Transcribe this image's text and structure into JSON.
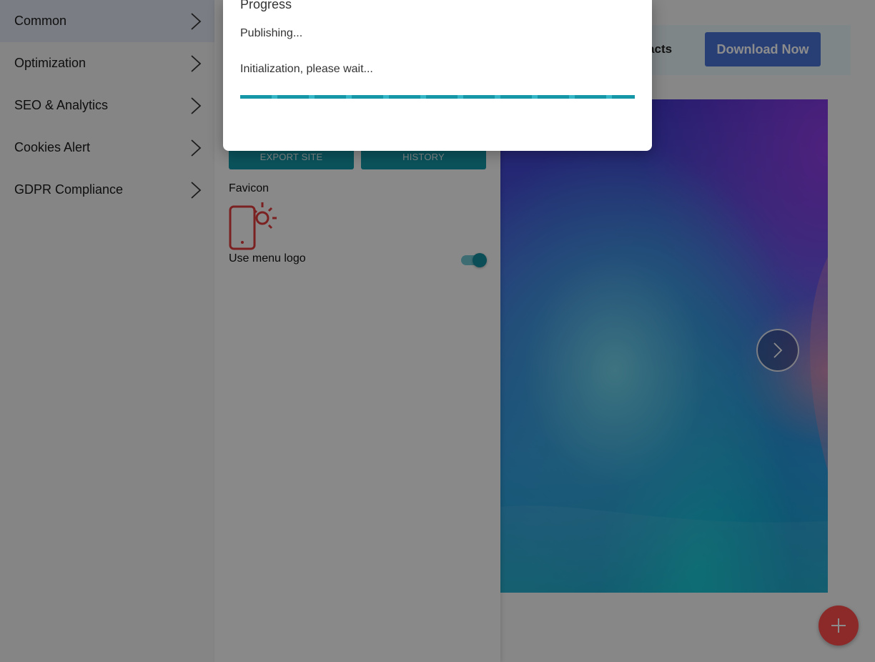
{
  "left_menu": {
    "items": [
      {
        "label": "Common",
        "active": true
      },
      {
        "label": "Optimization",
        "active": false
      },
      {
        "label": "SEO & Analytics",
        "active": false
      },
      {
        "label": "Cookies Alert",
        "active": false
      },
      {
        "label": "GDPR Compliance",
        "active": false
      }
    ]
  },
  "settings": {
    "export_label": "EXPORT SITE",
    "history_label": "HISTORY",
    "favicon_label": "Favicon",
    "use_menu_logo_label": "Use menu logo",
    "use_menu_logo_enabled": true
  },
  "preview": {
    "nav_link_partial": "ntacts",
    "download_label": "Download Now"
  },
  "modal": {
    "title": "Progress",
    "status": "Publishing...",
    "detail": "Initialization, please wait...",
    "progress_fraction": 1.0
  },
  "colors": {
    "accent_teal": "#1597a8",
    "download_blue": "#4a73d8",
    "fab_red": "#ff4b4b",
    "icon_red": "#e23c3c"
  },
  "icons": {
    "chevron": "chevron-right-icon",
    "next_slide": "chevron-right-icon",
    "fab": "plus-icon",
    "favicon": "phone-sun-icon"
  }
}
